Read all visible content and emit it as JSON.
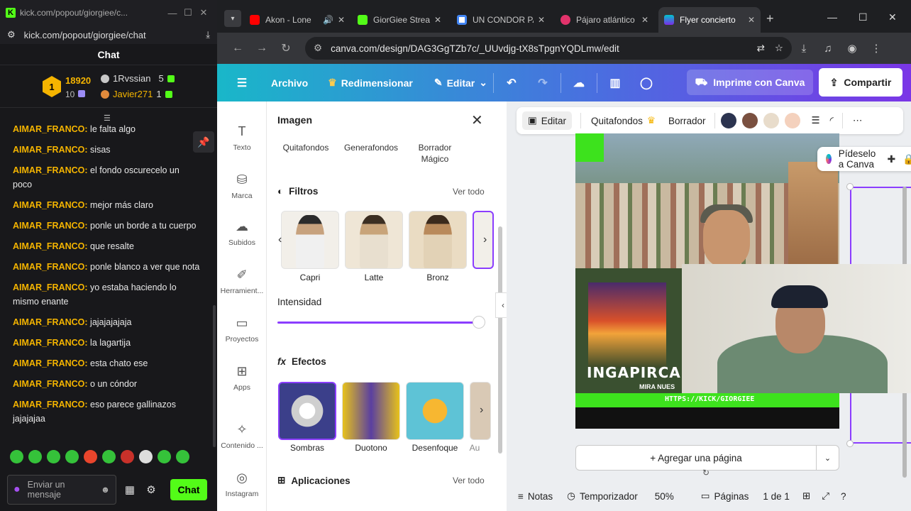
{
  "kick": {
    "window_title": "kick.com/popout/giorgiee/c...",
    "url": "kick.com/popout/giorgiee/chat",
    "chat_title": "Chat",
    "leaderboard": {
      "rank": "1",
      "top_count": "18920",
      "top_sub": "10",
      "second_user": "1Rvssian",
      "second_count": "5",
      "third_user": "Javier271",
      "third_count": "1"
    },
    "messages": [
      {
        "user": "AIMAR_FRANCO:",
        "text": "le falta algo"
      },
      {
        "user": "AIMAR_FRANCO:",
        "text": "sisas"
      },
      {
        "user": "AIMAR_FRANCO:",
        "text": "el fondo oscurecelo un poco"
      },
      {
        "user": "AIMAR_FRANCO:",
        "text": "mejor más claro"
      },
      {
        "user": "AIMAR_FRANCO:",
        "text": "ponle un borde a tu cuerpo"
      },
      {
        "user": "AIMAR_FRANCO:",
        "text": "que resalte"
      },
      {
        "user": "AIMAR_FRANCO:",
        "text": "ponle blanco a ver que nota"
      },
      {
        "user": "AIMAR_FRANCO:",
        "text": "yo estaba haciendo lo mismo enante"
      },
      {
        "user": "AIMAR_FRANCO:",
        "text": "jajajajajaja"
      },
      {
        "user": "AIMAR_FRANCO:",
        "text": "la lagartija"
      },
      {
        "user": "AIMAR_FRANCO:",
        "text": "esta chato ese"
      },
      {
        "user": "AIMAR_FRANCO:",
        "text": "o un cóndor"
      },
      {
        "user": "AIMAR_FRANCO:",
        "text": "eso parece gallinazos jajajajaa"
      }
    ],
    "input_placeholder": "Enviar un mensaje",
    "chat_button": "Chat",
    "accent": "#53fc18"
  },
  "browser": {
    "tabs": [
      {
        "label": "Akon - Lone",
        "favicon": "youtube"
      },
      {
        "label": "GiorGiee Stream",
        "favicon": "kick"
      },
      {
        "label": "UN CONDOR PASA",
        "favicon": "google"
      },
      {
        "label": "Pájaro atlántico",
        "favicon": "pink"
      },
      {
        "label": "Flyer concierto",
        "favicon": "canva",
        "active": true
      }
    ],
    "url": "canva.com/design/DAG3GgTZb7c/_UUvdjg-tX8sTpgnYQDLmw/edit"
  },
  "canva": {
    "menu": {
      "file": "Archivo",
      "resize": "Redimensionar",
      "edit": "Editar",
      "print": "Imprime con Canva",
      "share": "Compartir"
    },
    "rail": [
      "Texto",
      "Marca",
      "Subidos",
      "Herramient...",
      "Proyectos",
      "Apps",
      "Contenido ...",
      "Instagram"
    ],
    "panel": {
      "title": "Imagen",
      "tools": [
        "Quitafondos",
        "Generafondos",
        "Borrador Mágico"
      ],
      "filters_title": "Filtros",
      "see_all": "Ver todo",
      "filters": [
        "Capri",
        "Latte",
        "Bronz"
      ],
      "intensity_label": "Intensidad",
      "intensity": 100,
      "effects_title": "Efectos",
      "effects": [
        "Sombras",
        "Duotono",
        "Desenfoque",
        "Au"
      ],
      "apps_title": "Aplicaciones"
    },
    "context_toolbar": {
      "edit": "Editar",
      "remove_bg": "Quitafondos",
      "eraser": "Borrador",
      "swatches": [
        "#2c3450",
        "#7a5040",
        "#e8dccb",
        "#f4d1bd"
      ]
    },
    "ask_canva": "Pídeselo a Canva",
    "flyer": {
      "place": "INGAPIRCA",
      "subtitle": "MIRA NUES",
      "link": "HTTPS://KICK/GIORGIEE"
    },
    "add_page": "+ Agregar una página",
    "footer": {
      "notes": "Notas",
      "timer": "Temporizador",
      "zoom": "50%",
      "pages": "Páginas",
      "page_count": "1 de 1"
    }
  }
}
